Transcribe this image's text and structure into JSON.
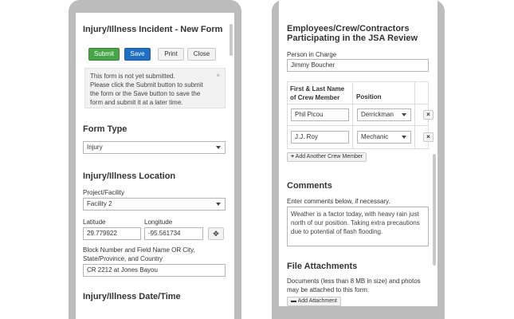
{
  "left_phone": {
    "form_title": "Injury/Illness Incident - New Form",
    "buttons": {
      "submit": "Submit",
      "save": "Save",
      "print": "Print",
      "close": "Close"
    },
    "alert": {
      "line1": "This form is not yet submitted.",
      "line2": "Please click the Submit button to submit",
      "line3": "the form or the Save button to save the",
      "line4": "form and submit it at a later time.",
      "close": "×"
    },
    "form_type": {
      "heading": "Form Type",
      "value": "Injury"
    },
    "location": {
      "heading": "Injury/Illness Location",
      "project_label": "Project/Facility",
      "project_value": "Facility 2",
      "latitude_label": "Latitude",
      "latitude_value": "29.779922",
      "longitude_label": "Longitude",
      "longitude_value": "-95.561734",
      "address_label_line1": "Block Number and Field Name OR City,",
      "address_label_line2": "State/Province, and Country",
      "address_value": "CR 2212 at Jones Bayou"
    },
    "date_heading": "Injury/Illness Date/Time"
  },
  "right_phone": {
    "crew_heading_line1": "Employees/Crew/Contractors",
    "crew_heading_line2": "Participating in the JSA Review",
    "person_label": "Person in Charge",
    "person_value": "Jimmy Boucher",
    "table": {
      "col1_line1": "First & Last Name",
      "col1_line2": "of Crew Member",
      "col2": "Position",
      "rows": [
        {
          "name": "Phil Picou",
          "position": "Derrickman",
          "remove": "×"
        },
        {
          "name": "J.J. Roy",
          "position": "Mechanic",
          "remove": "×"
        }
      ]
    },
    "add_crew_label": "Add Another Crew Member",
    "comments": {
      "heading": "Comments",
      "label": "Enter comments below, if necessary.",
      "line1": "Weather is a factor today, with heavy rain just",
      "line2": "north of our position. Taking extra precautions",
      "line3": "due to potential of flash flooding."
    },
    "attachments": {
      "heading": "File Attachments",
      "label_line1": "Documents (less than 8 MB in size) and photos",
      "label_line2": "may be attached to this form.",
      "add_label": "Add Attachment"
    }
  }
}
